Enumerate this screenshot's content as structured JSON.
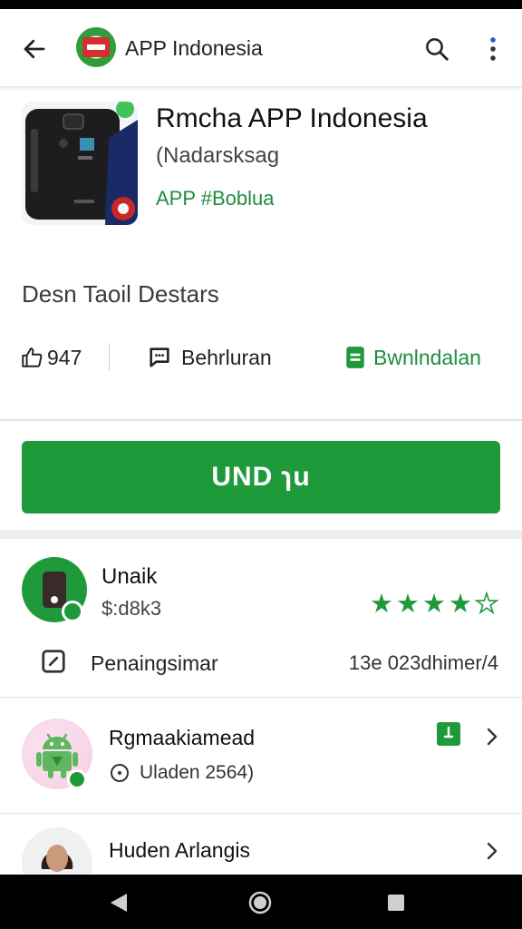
{
  "app_bar": {
    "title": "APP Indonesia"
  },
  "app": {
    "name": "Rmcha APP Indonesia",
    "subtitle": "(Nadarsksag",
    "developer": "APP #Boblua"
  },
  "description_title": "Desn Taoil Destars",
  "meta": {
    "likes": "947",
    "comments_label": "Behrluran",
    "download_label": "Bwnlndalan"
  },
  "install_button": "UND ɿu",
  "review": {
    "name": "Unaik",
    "price": "$:d8k3",
    "rating": 4,
    "rating_max": 5,
    "pending_label": "Penaingsimar",
    "pending_value": "13e 023dhimer/4"
  },
  "item2": {
    "title": "Rgmaakiamead",
    "subtitle": "Uladen 2564)"
  },
  "item3": {
    "title": "Huden Arlangis"
  },
  "colors": {
    "accent_green": "#1f9a3b",
    "text_dark": "#222222"
  }
}
